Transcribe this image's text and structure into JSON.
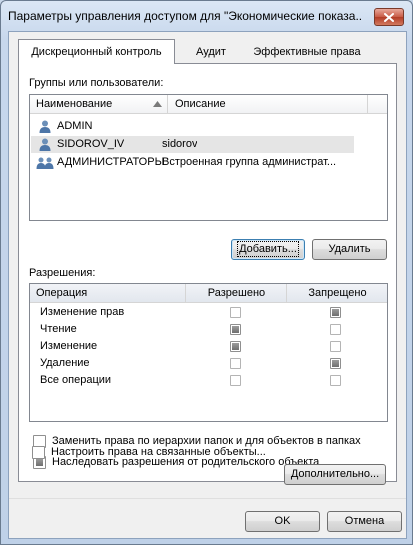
{
  "window": {
    "title": "Параметры управления доступом для \"Экономические показа..."
  },
  "tabs": [
    {
      "label": "Дискреционный контроль",
      "active": true
    },
    {
      "label": "Аудит",
      "active": false
    },
    {
      "label": "Эффективные права",
      "active": false
    }
  ],
  "users_section": {
    "label": "Группы или пользователи:",
    "columns": {
      "name": "Наименование",
      "description": "Описание",
      "sort_icon": "sort-ascending-icon"
    },
    "rows": [
      {
        "icon": "user-icon",
        "name": "ADMIN",
        "description": "",
        "selected": false
      },
      {
        "icon": "user-icon",
        "name": "SIDOROV_IV",
        "description": "sidorov",
        "selected": true
      },
      {
        "icon": "group-icon",
        "name": "АДМИНИСТРАТОРЫ",
        "description": "Встроенная группа администрат...",
        "selected": false
      }
    ],
    "add_button": "Добавить...",
    "remove_button": "Удалить"
  },
  "permissions_section": {
    "label": "Разрешения:",
    "columns": {
      "operation": "Операция",
      "allowed": "Разрешено",
      "denied": "Запрещено"
    },
    "rows": [
      {
        "operation": "Изменение прав",
        "allowed": "empty",
        "denied": "indeterminate"
      },
      {
        "operation": "Чтение",
        "allowed": "indeterminate",
        "denied": "empty"
      },
      {
        "operation": "Изменение",
        "allowed": "indeterminate",
        "denied": "empty"
      },
      {
        "operation": "Удаление",
        "allowed": "empty",
        "denied": "indeterminate"
      },
      {
        "operation": "Все операции",
        "allowed": "empty",
        "denied": "empty"
      }
    ]
  },
  "options": [
    {
      "label": "Заменить права по иерархии папок и для объектов в папках",
      "state": "empty"
    },
    {
      "label": "Наследовать разрешения от родительского объекта",
      "state": "indeterminate"
    },
    {
      "label": "Настроить права на связанные объекты...",
      "state": "empty"
    }
  ],
  "advanced_button": "Дополнительно...",
  "footer": {
    "ok": "OK",
    "cancel": "Отмена"
  },
  "colors": {
    "selection": "#e5e5e5",
    "accent": "#3c7fb1",
    "close": "#c75a45"
  }
}
